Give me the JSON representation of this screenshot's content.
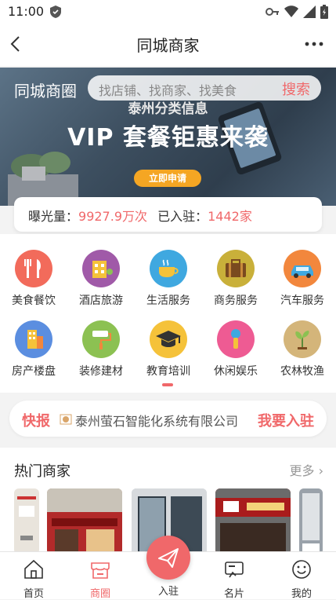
{
  "status": {
    "time": "11:00"
  },
  "header": {
    "title": "同城商家"
  },
  "banner": {
    "brand": "同城商圈",
    "search_placeholder": "找店铺、找商家、找美食",
    "search_button": "搜索",
    "subtitle": "泰州分类信息",
    "headline": "VIP 套餐钜惠来袭",
    "apply_button": "立即申请"
  },
  "stats": {
    "exposure_label": "曝光量：",
    "exposure_value": "9927.9万次",
    "joined_label": "已入驻：",
    "joined_value": "1442家"
  },
  "categories": [
    {
      "label": "美食餐饮",
      "icon": "cutlery-icon",
      "color": "#f26b5b"
    },
    {
      "label": "酒店旅游",
      "icon": "hotel-icon",
      "color": "#a05aa8"
    },
    {
      "label": "生活服务",
      "icon": "coffee-cup-icon",
      "color": "#3fa8e0"
    },
    {
      "label": "商务服务",
      "icon": "briefcase-icon",
      "color": "#c9b03a"
    },
    {
      "label": "汽车服务",
      "icon": "car-icon",
      "color": "#f2873d"
    },
    {
      "label": "房产楼盘",
      "icon": "building-icon",
      "color": "#5b8ee0"
    },
    {
      "label": "装修建材",
      "icon": "paint-roller-icon",
      "color": "#8cc152"
    },
    {
      "label": "教育培训",
      "icon": "graduation-cap-icon",
      "color": "#f5c23a"
    },
    {
      "label": "休闲娱乐",
      "icon": "microphone-icon",
      "color": "#ee5b93"
    },
    {
      "label": "农林牧渔",
      "icon": "sprout-icon",
      "color": "#d4b57a"
    }
  ],
  "news": {
    "tag": "快报",
    "text": "泰州萤石智能化系统有限公司",
    "join_button": "我要入驻"
  },
  "hot": {
    "title": "热门商家",
    "more": "更多"
  },
  "tabs": [
    {
      "label": "首页",
      "icon": "home-icon"
    },
    {
      "label": "商圈",
      "icon": "store-icon",
      "active": true
    },
    {
      "label": "入驻",
      "icon": "paper-plane-icon"
    },
    {
      "label": "名片",
      "icon": "card-icon"
    },
    {
      "label": "我的",
      "icon": "smile-icon"
    }
  ],
  "colors": {
    "accent": "#f0686a"
  }
}
